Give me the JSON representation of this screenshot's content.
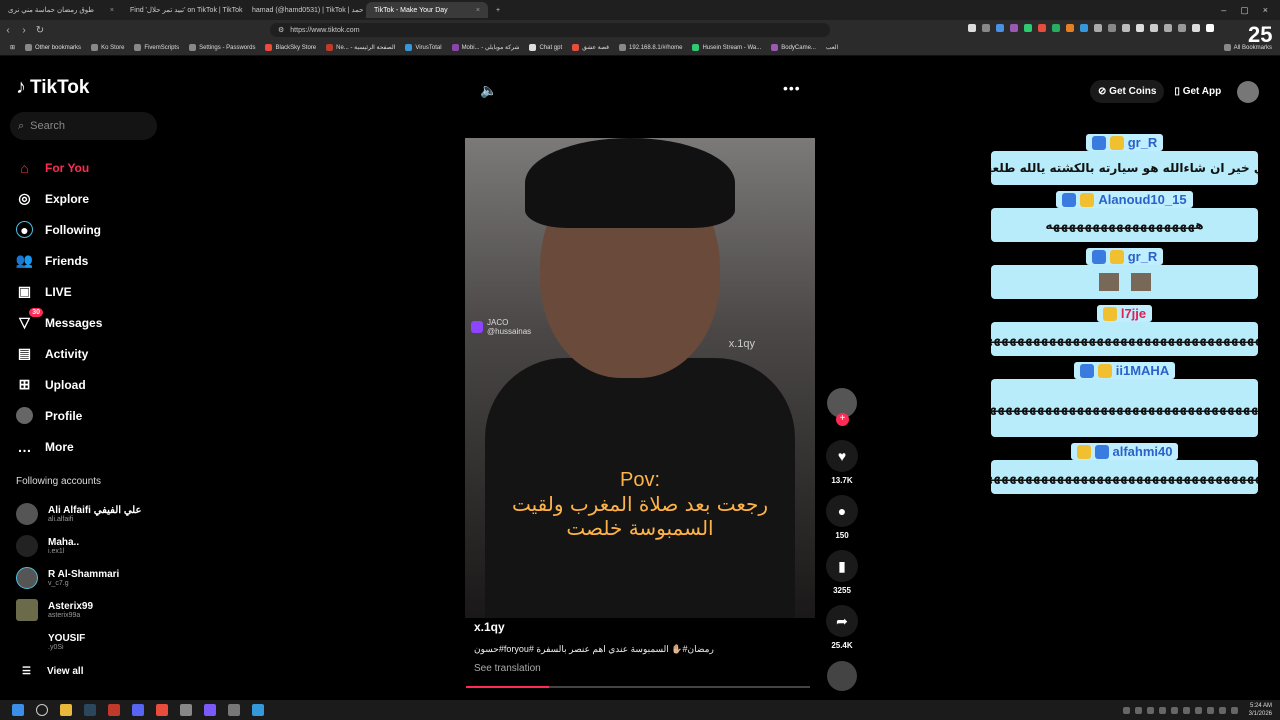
{
  "browser": {
    "tabs": [
      {
        "label": "طوق رمضان حماسة مني نرى"
      },
      {
        "label": "Find 'تبيد تمر حلال' on TikTok | TikTok"
      },
      {
        "label": "hamad (@hamd0531) | TikTok | حمد"
      },
      {
        "label": "TikTok - Make Your Day"
      }
    ],
    "url": "https://www.tiktok.com",
    "bookmarks": [
      "Other bookmarks",
      "Ko Store",
      "FivemScripts",
      "Settings - Passwords",
      "BlackSky Store",
      "Ne... - الصفحة الرئيسية",
      "VirusTotal",
      "Mobi... - شركة موبايلي",
      "Chat gpt",
      "قصة عشق",
      "192.168.8.1/#/home",
      "Husein Stream - Wa...",
      "BodyCame...",
      "العب"
    ],
    "all_bookmarks": "All Bookmarks"
  },
  "tiktok": {
    "logo": "TikTok",
    "search_placeholder": "Search",
    "nav": [
      {
        "label": "For You",
        "icon": "home-icon"
      },
      {
        "label": "Explore",
        "icon": "compass-icon"
      },
      {
        "label": "Following",
        "icon": "following-icon"
      },
      {
        "label": "Friends",
        "icon": "friends-icon"
      },
      {
        "label": "LIVE",
        "icon": "live-icon"
      },
      {
        "label": "Messages",
        "icon": "messages-icon",
        "badge": "30"
      },
      {
        "label": "Activity",
        "icon": "activity-icon"
      },
      {
        "label": "Upload",
        "icon": "upload-icon"
      },
      {
        "label": "Profile",
        "icon": "profile-icon"
      },
      {
        "label": "More",
        "icon": "more-icon"
      }
    ],
    "following_title": "Following accounts",
    "following": [
      {
        "name": "Ali Alfaifi علي الفيفي",
        "handle": "ali.alfaifi"
      },
      {
        "name": "Maha..",
        "handle": "i.ex1l"
      },
      {
        "name": "R Al-Shammari",
        "handle": "v_c7.g"
      },
      {
        "name": "Asterix99",
        "handle": "asterix99a"
      },
      {
        "name": "YOUSIF",
        "handle": ".y0Si"
      }
    ],
    "view_all": "View all",
    "get_coins": "Get Coins",
    "get_app": "Get App"
  },
  "video": {
    "overlay_tag": "JACO",
    "overlay_handle": "@hussainas",
    "watermark": "x.1qy",
    "pov": "Pov:",
    "caption_line1": "رجعت بعد صلاة المغرب ولقيت",
    "caption_line2": "السمبوسة خلصت",
    "username": "x.1qy",
    "description": "حسون#foryou# رمضان#✋🏼 السمبوسة عندي اهم عنصر بالسفرة",
    "see_translation": "See translation",
    "progress": 0.24,
    "likes": "13.7K",
    "comments": "150",
    "saves": "3255",
    "shares": "25.4K"
  },
  "chat": [
    {
      "user": "gr_R",
      "text": "اي خير ان شاءالله هو سيارته بالكشته يالله طلعها"
    },
    {
      "user": "Alanoud10_15",
      "text": "هههههههههههههههههههه"
    },
    {
      "user": "gr_R",
      "text": ""
    },
    {
      "user": "l7jje",
      "text": "ههههههههههههههههههههههههههههههههههههههههه"
    },
    {
      "user": "ii1MAHA",
      "text": "هههههههههههههههههههههههههههههههههههههههههههه"
    },
    {
      "user": "alfahmi40",
      "text": "ههههههههههههههههههههههههههههههههههههههههه"
    }
  ],
  "overlay_number": "25",
  "taskbar": {
    "time": "5:24 AM",
    "date": "3/1/2026"
  }
}
